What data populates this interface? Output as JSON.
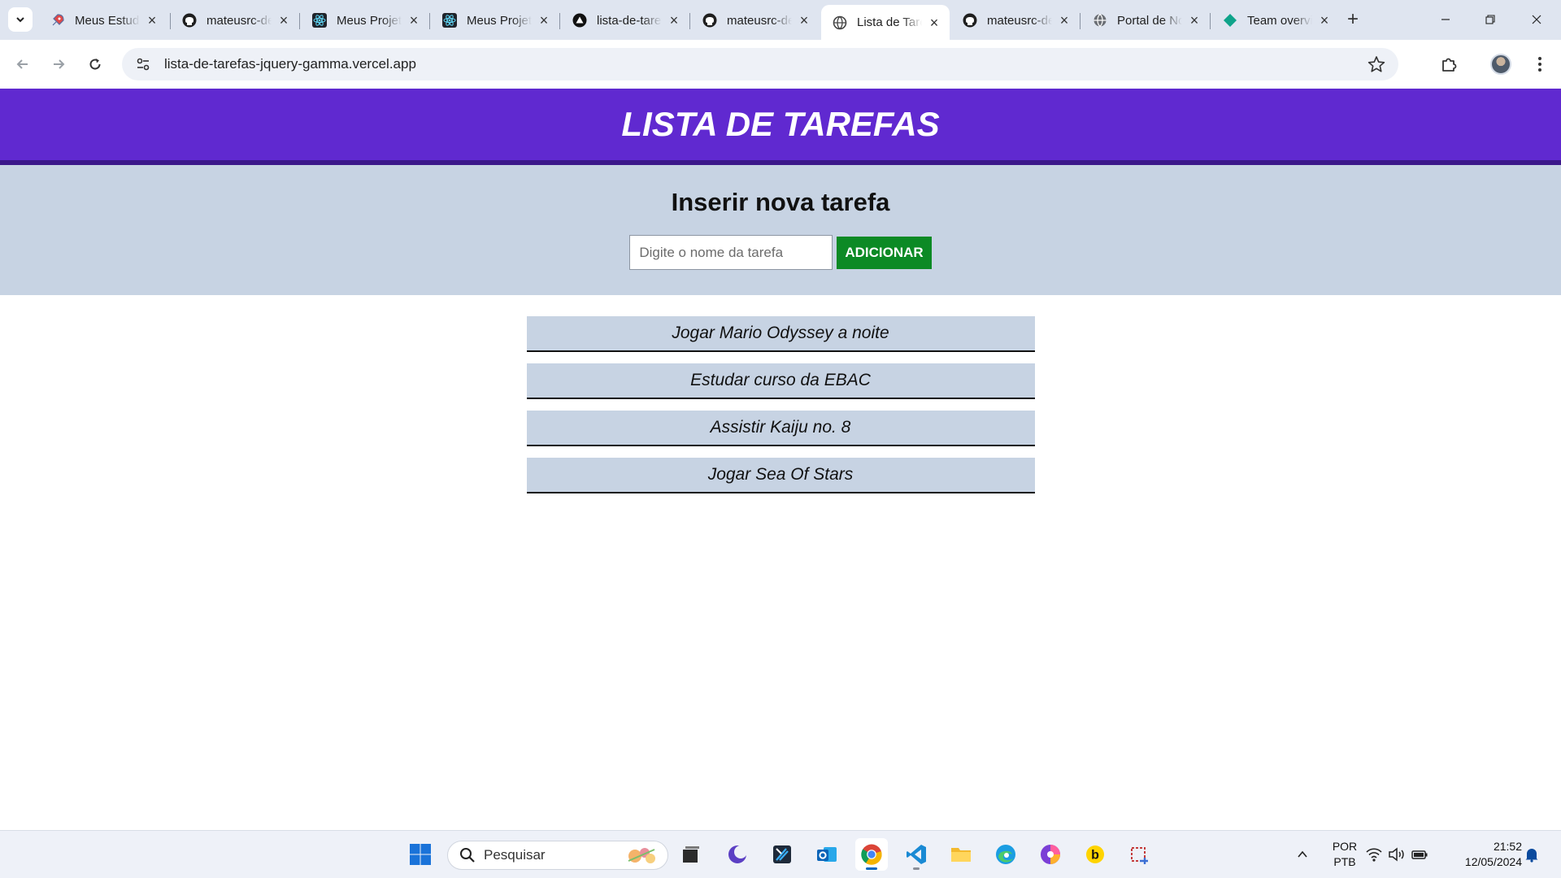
{
  "browser": {
    "tabs": [
      {
        "title": "Meus Estudos",
        "icon": "rocket-icon"
      },
      {
        "title": "mateusrc-dev",
        "icon": "github-icon"
      },
      {
        "title": "Meus Projetos",
        "icon": "react-icon"
      },
      {
        "title": "Meus Projetos",
        "icon": "react-icon"
      },
      {
        "title": "lista-de-tarefas",
        "icon": "vercel-icon"
      },
      {
        "title": "mateusrc-dev",
        "icon": "github-icon"
      },
      {
        "title": "Lista de Tarefas",
        "icon": "globe-icon",
        "active": true
      },
      {
        "title": "mateusrc-dev",
        "icon": "github-icon"
      },
      {
        "title": "Portal de Notícias",
        "icon": "globe-icon"
      },
      {
        "title": "Team overview",
        "icon": "diamond-icon"
      }
    ],
    "url": "lista-de-tarefas-jquery-gamma.vercel.app"
  },
  "page": {
    "header_title": "LISTA DE TAREFAS",
    "form_title": "Inserir nova tarefa",
    "input_placeholder": "Digite o nome da tarefa",
    "add_button_label": "ADICIONAR",
    "tasks": [
      "Jogar Mario Odyssey a noite",
      "Estudar curso da EBAC",
      "Assistir Kaiju no. 8",
      "Jogar Sea Of Stars"
    ]
  },
  "taskbar": {
    "search_label": "Pesquisar",
    "lang_primary": "POR",
    "lang_secondary": "PTB",
    "time": "21:52",
    "date": "12/05/2024"
  },
  "colors": {
    "header_bg": "#6029d0",
    "form_bg": "#c7d3e3",
    "button_bg": "#0c8a25"
  }
}
